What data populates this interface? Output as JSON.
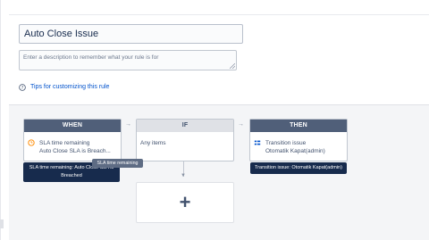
{
  "rule": {
    "name": "Auto Close Issue",
    "description_placeholder": "Enter a description to remember what your rule is for",
    "tips_link": "Tips for customizing this rule"
  },
  "flow": {
    "when": {
      "header": "WHEN",
      "line1": "SLA time remaining",
      "line2": "Auto Close SLA is Breach..."
    },
    "if": {
      "header": "IF",
      "line1": "Any items"
    },
    "then": {
      "header": "THEN",
      "line1": "Transition issue",
      "line2": "Otomatik Kapat(admin)"
    },
    "add_label": "+"
  },
  "tooltips": {
    "trigger": "SLA time remaining: Auto Close SLA is Breached",
    "small": "SLA time remaining",
    "action": "Transition issue: Otomatik Kapat(admin)"
  },
  "colors": {
    "link": "#0052cc",
    "header_dark": "#505f79",
    "header_light": "#dfe1e6",
    "tooltip": "#172b4d",
    "clock_icon": "#ff8b00"
  },
  "icons": {
    "help": "question-circle-icon",
    "trigger": "clock-icon",
    "action": "transition-icon",
    "add": "plus-icon"
  }
}
